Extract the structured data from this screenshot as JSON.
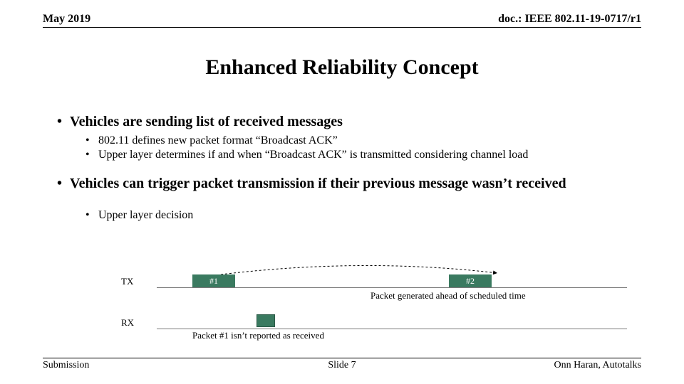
{
  "header": {
    "date": "May 2019",
    "doc": "doc.: IEEE 802.11-19-0717/r1"
  },
  "title": "Enhanced Reliability Concept",
  "bullets": {
    "b1a": "Vehicles are sending list of received messages",
    "b1a_sub1": "802.11 defines new packet format “Broadcast ACK”",
    "b1a_sub2": "Upper layer determines if and when “Broadcast ACK” is transmitted considering channel load",
    "b1b": "Vehicles can trigger packet transmission if their previous message wasn’t received",
    "b1b_sub1": "Upper layer decision"
  },
  "diagram": {
    "tx_label": "TX",
    "rx_label": "RX",
    "pkt1": "#1",
    "pkt2": "#2",
    "tx_caption": "Packet generated ahead of scheduled time",
    "rx_caption": "Packet #1 isn’t reported as received"
  },
  "footer": {
    "left": "Submission",
    "center": "Slide 7",
    "right": "Onn Haran, Autotalks"
  }
}
